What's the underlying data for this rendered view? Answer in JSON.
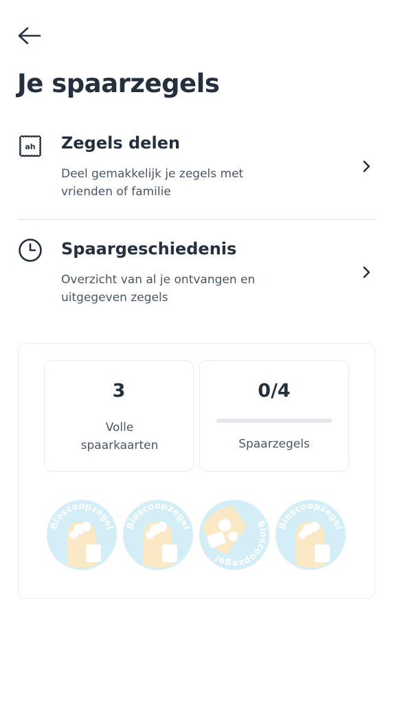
{
  "header": {
    "back_icon": "arrow-left-icon",
    "title": "Je spaarzegels"
  },
  "menu": [
    {
      "icon": "stamp-share-icon",
      "title": "Zegels delen",
      "description": "Deel gemakkelijk je zegels met vrienden of familie",
      "chevron": "chevron-right-icon"
    },
    {
      "icon": "clock-icon",
      "title": "Spaargeschiedenis",
      "description": "Overzicht van al je ontvangen en uitgegeven zegels",
      "chevron": "chevron-right-icon"
    }
  ],
  "summary": {
    "full_cards": {
      "value": "3",
      "label": "Volle spaarkaarten"
    },
    "stamps": {
      "value": "0/4",
      "label": "Spaarzegels",
      "progress_fraction": 0
    }
  },
  "stamp_slots": [
    {
      "text": "Bioscoopzegel"
    },
    {
      "text": "Bioscoopzegel"
    },
    {
      "text": "Bioscoopzegel"
    },
    {
      "text": "Bioscoopzegel"
    }
  ],
  "colors": {
    "text_primary": "#25303f",
    "text_secondary": "#4a5566",
    "divider": "#dadde2",
    "stamp_blue": "#8fd3ee",
    "stamp_yellow": "#f3c766"
  }
}
